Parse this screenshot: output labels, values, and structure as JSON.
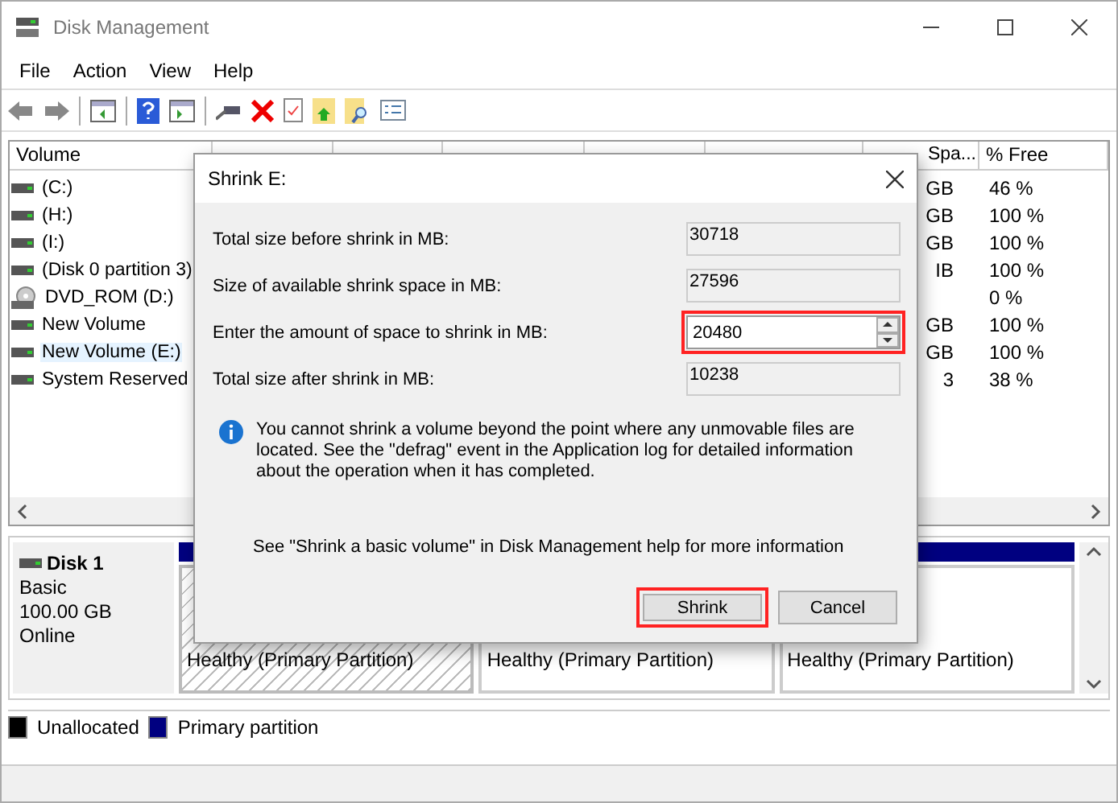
{
  "window": {
    "title": "Disk Management"
  },
  "menu": [
    "File",
    "Action",
    "View",
    "Help"
  ],
  "volume_table": {
    "columns": [
      "Volume",
      "Spa...",
      "% Free"
    ],
    "rows": [
      {
        "volume": "(C:)",
        "kind": "disk",
        "free_space": "GB",
        "percent_free": "46 %",
        "selected": false
      },
      {
        "volume": "(H:)",
        "kind": "disk",
        "free_space": "GB",
        "percent_free": "100 %",
        "selected": false
      },
      {
        "volume": "(I:)",
        "kind": "disk",
        "free_space": "GB",
        "percent_free": "100 %",
        "selected": false
      },
      {
        "volume": "(Disk 0 partition 3)",
        "kind": "disk",
        "free_space": "IB",
        "percent_free": "100 %",
        "selected": false
      },
      {
        "volume": "DVD_ROM (D:)",
        "kind": "dvd",
        "percent_free": "0 %",
        "selected": false
      },
      {
        "volume": "New Volume",
        "kind": "disk",
        "free_space": "GB",
        "percent_free": "100 %",
        "selected": false
      },
      {
        "volume": "New Volume (E:)",
        "kind": "disk",
        "free_space": "GB",
        "percent_free": "100 %",
        "selected": true
      },
      {
        "volume": "System Reserved",
        "kind": "disk",
        "free_space": "3",
        "percent_free": "38 %",
        "selected": false
      }
    ]
  },
  "disk": {
    "name": "Disk 1",
    "type": "Basic",
    "size": "100.00 GB",
    "state": "Online",
    "partitions": [
      {
        "status": "Healthy (Primary Partition)",
        "selected": true
      },
      {
        "status": "Healthy (Primary Partition)",
        "selected": false
      },
      {
        "status": "Healthy (Primary Partition)",
        "selected": false
      }
    ]
  },
  "legend": [
    {
      "label": "Unallocated",
      "color": "#000000"
    },
    {
      "label": "Primary partition",
      "color": "#000080"
    }
  ],
  "dialog": {
    "title": "Shrink E:",
    "fields": [
      {
        "label": "Total size before shrink in MB:",
        "value": "30718",
        "kind": "readonly"
      },
      {
        "label": "Size of available shrink space in MB:",
        "value": "27596",
        "kind": "readonly"
      },
      {
        "label": "Enter the amount of space to shrink in MB:",
        "value": "20480",
        "kind": "spin"
      },
      {
        "label": "Total size after shrink in MB:",
        "value": "10238",
        "kind": "readonly"
      }
    ],
    "info": "You cannot shrink a volume beyond the point where any unmovable files are located. See the \"defrag\" event in the Application log for detailed information about the operation when it has completed.",
    "help": "See \"Shrink a basic volume\" in Disk Management help for more information",
    "buttons": [
      {
        "label": "Shrink",
        "highlighted": true
      },
      {
        "label": "Cancel",
        "highlighted": false
      }
    ]
  }
}
